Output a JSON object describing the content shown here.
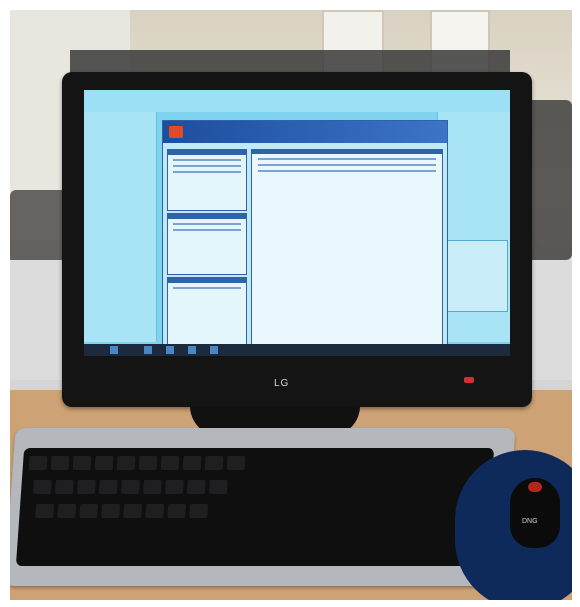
{
  "photo": {
    "monitor_brand": "LG",
    "mouse_brand": "DNG"
  },
  "screen": {
    "app_title": ""
  }
}
